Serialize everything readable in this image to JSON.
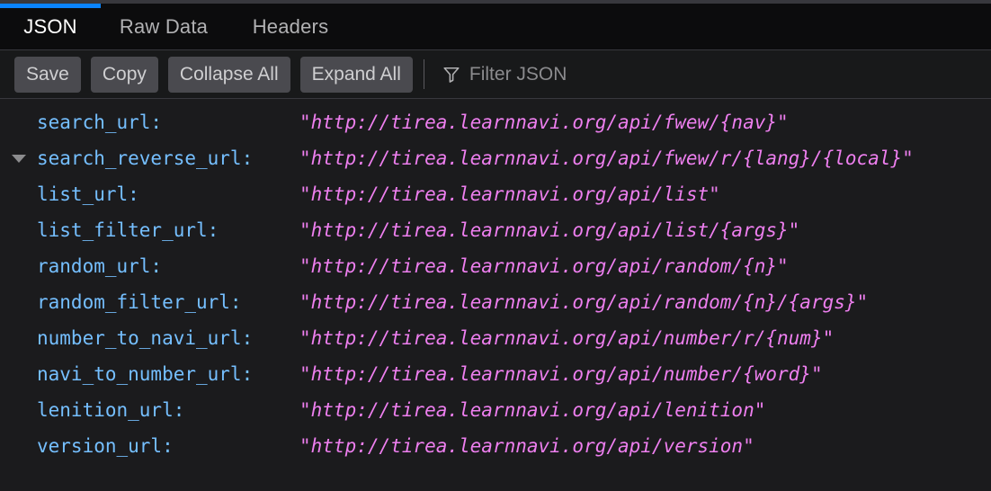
{
  "tabs": [
    {
      "label": "JSON",
      "selected": true
    },
    {
      "label": "Raw Data",
      "selected": false
    },
    {
      "label": "Headers",
      "selected": false
    }
  ],
  "accent_color": "#0a84ff",
  "toolbar": {
    "save_label": "Save",
    "copy_label": "Copy",
    "collapse_all_label": "Collapse All",
    "expand_all_label": "Expand All",
    "filter_icon": "filter-funnel-icon",
    "filter_placeholder": "Filter JSON",
    "filter_value": ""
  },
  "json_rows": [
    {
      "twisty": "none",
      "key": "search_url:",
      "value": "\"http://tirea.learnnavi.org/api/fwew/{nav}\""
    },
    {
      "twisty": "down",
      "key": "search_reverse_url:",
      "value": "\"http://tirea.learnnavi.org/api/fwew/r/{lang}/{local}\""
    },
    {
      "twisty": "none",
      "key": "list_url:",
      "value": "\"http://tirea.learnnavi.org/api/list\""
    },
    {
      "twisty": "none",
      "key": "list_filter_url:",
      "value": "\"http://tirea.learnnavi.org/api/list/{args}\""
    },
    {
      "twisty": "none",
      "key": "random_url:",
      "value": "\"http://tirea.learnnavi.org/api/random/{n}\""
    },
    {
      "twisty": "none",
      "key": "random_filter_url:",
      "value": "\"http://tirea.learnnavi.org/api/random/{n}/{args}\""
    },
    {
      "twisty": "none",
      "key": "number_to_navi_url:",
      "value": "\"http://tirea.learnnavi.org/api/number/r/{num}\""
    },
    {
      "twisty": "none",
      "key": "navi_to_number_url:",
      "value": "\"http://tirea.learnnavi.org/api/number/{word}\""
    },
    {
      "twisty": "none",
      "key": "lenition_url:",
      "value": "\"http://tirea.learnnavi.org/api/lenition\""
    },
    {
      "twisty": "none",
      "key": "version_url:",
      "value": "\"http://tirea.learnnavi.org/api/version\""
    }
  ],
  "colors": {
    "key": "#75bfff",
    "value": "#ee7fef",
    "tabbar_bg": "#0c0c0d",
    "toolbar_bg": "#18191a",
    "body_bg": "#1b1b1d"
  }
}
